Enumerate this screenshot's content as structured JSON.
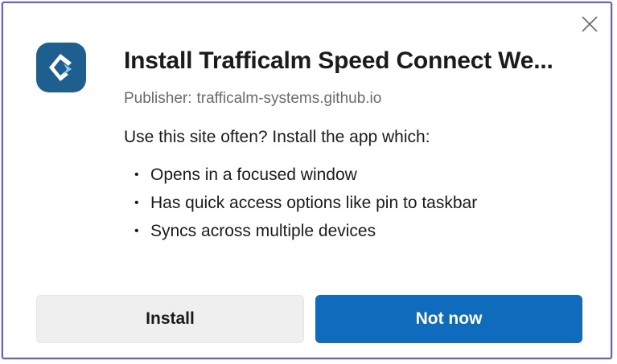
{
  "dialog": {
    "title": "Install Trafficalm Speed Connect We...",
    "publisher_label": "Publisher:",
    "publisher_value": "trafficalm-systems.github.io",
    "intro": "Use this site often? Install the app which:",
    "features": [
      "Opens in a focused window",
      "Has quick access options like pin to taskbar",
      "Syncs across multiple devices"
    ],
    "bullet": "•",
    "buttons": {
      "install": "Install",
      "not_now": "Not now"
    },
    "icons": {
      "close": "close-icon",
      "app": "trafficalm-app-icon"
    }
  },
  "colors": {
    "dialog_border": "#6b5fd3",
    "app_icon_bg": "#1d5f8f",
    "primary_button": "#0f6cbd",
    "secondary_button": "#efefef",
    "publisher_text": "#6b6b6b"
  }
}
